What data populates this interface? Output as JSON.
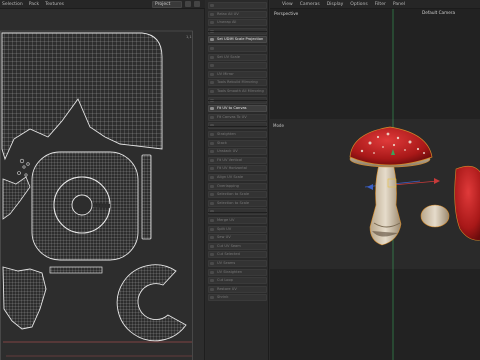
{
  "uv_editor": {
    "menus": [
      "Selection",
      "Pack",
      "Textures"
    ],
    "project_dropdown": "Project",
    "tile_label": "1,1"
  },
  "tools": {
    "items": [
      {
        "label": "",
        "highlight": false
      },
      {
        "label": "Relax All UV",
        "highlight": false
      },
      {
        "label": "Unwrap All",
        "highlight": false
      },
      {
        "label": "",
        "highlight": false
      },
      {
        "label": "Set UDIM Scale Projection",
        "highlight": true
      },
      {
        "label": "",
        "highlight": false
      },
      {
        "label": "Set UV Scale",
        "highlight": false
      },
      {
        "label": "",
        "highlight": false
      },
      {
        "label": "UV Mirror",
        "highlight": false
      },
      {
        "label": "Tools Rebuild Mirroring",
        "highlight": false
      },
      {
        "label": "Tools Smooth All Mirroring",
        "highlight": false
      },
      {
        "label": "",
        "highlight": false
      },
      {
        "label": "Fit UV to Canvas",
        "highlight": true
      },
      {
        "label": "Fit Canvas To UV",
        "highlight": false
      },
      {
        "label": "",
        "highlight": false
      },
      {
        "label": "Straighten",
        "highlight": false
      },
      {
        "label": "Stack",
        "highlight": false
      },
      {
        "label": "Unstack UV",
        "highlight": false
      },
      {
        "label": "Fit UV Vertical",
        "highlight": false
      },
      {
        "label": "Fit UV Horizontal",
        "highlight": false
      },
      {
        "label": "Align UV Scale",
        "highlight": false
      },
      {
        "label": "Overlapping",
        "highlight": false
      },
      {
        "label": "Selection to Scale",
        "highlight": false
      },
      {
        "label": "Selection to Scale",
        "highlight": false
      },
      {
        "label": "",
        "highlight": false
      },
      {
        "label": "Merge UV",
        "highlight": false
      },
      {
        "label": "Split UV",
        "highlight": false
      },
      {
        "label": "Sew UV",
        "highlight": false
      },
      {
        "label": "Cut UV Seam",
        "highlight": false
      },
      {
        "label": "Cut Selected",
        "highlight": false
      },
      {
        "label": "UV Seams",
        "highlight": false
      },
      {
        "label": "UV Straighten",
        "highlight": false
      },
      {
        "label": "Cut Loop",
        "highlight": false
      },
      {
        "label": "Restore UV",
        "highlight": false
      },
      {
        "label": "Shrink",
        "highlight": false
      }
    ]
  },
  "viewport": {
    "menus": [
      "View",
      "Cameras",
      "Display",
      "Options",
      "Filter",
      "Panel"
    ],
    "perspective_label": "Perspective",
    "camera_label": "Default Camera",
    "mode_label": "Mode"
  }
}
